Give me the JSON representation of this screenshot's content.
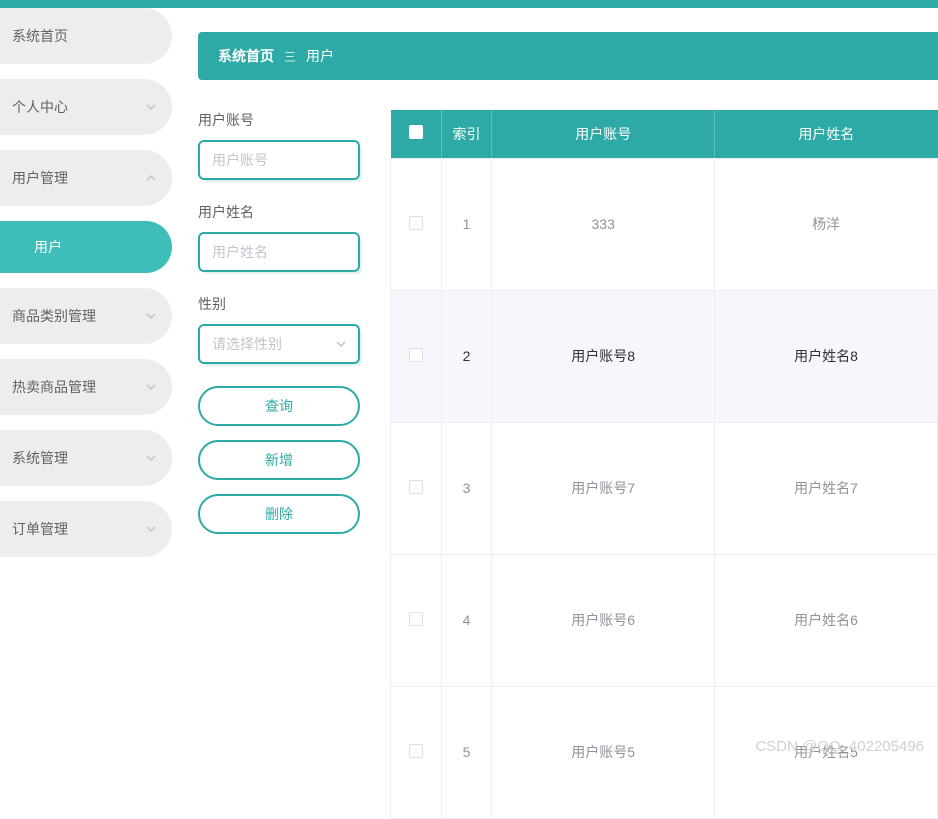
{
  "sidebar": {
    "items": [
      {
        "label": "系统首页",
        "expandable": false
      },
      {
        "label": "个人中心",
        "expandable": true
      },
      {
        "label": "用户管理",
        "expandable": true,
        "expanded": true,
        "children": [
          {
            "label": "用户"
          }
        ]
      },
      {
        "label": "商品类别管理",
        "expandable": true
      },
      {
        "label": "热卖商品管理",
        "expandable": true
      },
      {
        "label": "系统管理",
        "expandable": true
      },
      {
        "label": "订单管理",
        "expandable": true
      }
    ]
  },
  "breadcrumb": {
    "home": "系统首页",
    "separator": "三",
    "current": "用户"
  },
  "filters": {
    "account": {
      "label": "用户账号",
      "placeholder": "用户账号",
      "value": ""
    },
    "name": {
      "label": "用户姓名",
      "placeholder": "用户姓名",
      "value": ""
    },
    "gender": {
      "label": "性别",
      "placeholder": "请选择性别",
      "value": ""
    },
    "buttons": {
      "query": "查询",
      "add": "新增",
      "delete": "删除"
    }
  },
  "table": {
    "columns": {
      "index": "索引",
      "account": "用户账号",
      "name": "用户姓名"
    },
    "rows": [
      {
        "index": "1",
        "account": "333",
        "name": "杨洋",
        "active": false
      },
      {
        "index": "2",
        "account": "用户账号8",
        "name": "用户姓名8",
        "active": true
      },
      {
        "index": "3",
        "account": "用户账号7",
        "name": "用户姓名7",
        "active": false
      },
      {
        "index": "4",
        "account": "用户账号6",
        "name": "用户姓名6",
        "active": false
      },
      {
        "index": "5",
        "account": "用户账号5",
        "name": "用户姓名5",
        "active": false
      }
    ]
  },
  "watermark": "CSDN @QQ_402205496"
}
